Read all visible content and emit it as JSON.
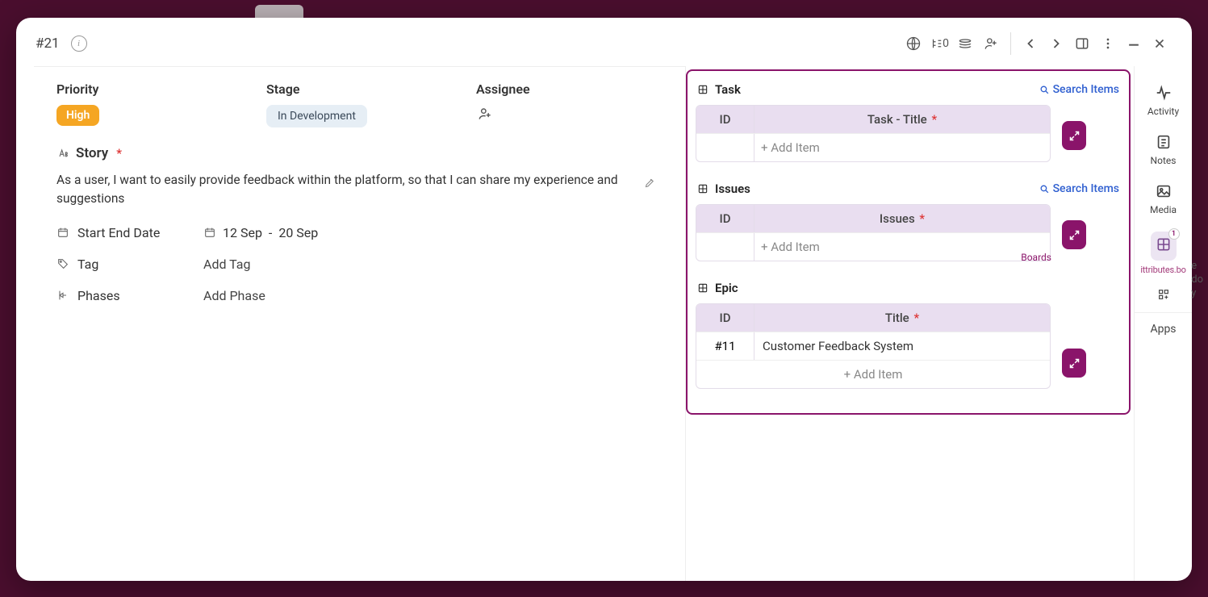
{
  "header": {
    "ticket_id": "#21",
    "link_count": "0"
  },
  "fields": {
    "priority_label": "Priority",
    "priority_value": "High",
    "stage_label": "Stage",
    "stage_value": "In Development",
    "assignee_label": "Assignee"
  },
  "story": {
    "label": "Story",
    "text": "As a user, I want to easily provide feedback within the platform, so that I can share my experience and suggestions"
  },
  "dates": {
    "label": "Start End Date",
    "start": "12 Sep",
    "end": "20 Sep",
    "sep": "-"
  },
  "tag": {
    "label": "Tag",
    "placeholder": "Add Tag"
  },
  "phases": {
    "label": "Phases",
    "placeholder": "Add Phase"
  },
  "relations": {
    "search": "Search Items",
    "boards_tooltip": "Boards",
    "task": {
      "title": "Task",
      "col_id": "ID",
      "col_title": "Task - Title",
      "add": "+ Add Item"
    },
    "issues": {
      "title": "Issues",
      "col_id": "ID",
      "col_title": "Issues",
      "add": "+ Add Item"
    },
    "epic": {
      "title": "Epic",
      "col_id": "ID",
      "col_title": "Title",
      "row_id": "#11",
      "row_title": "Customer Feedback System",
      "add": "+ Add Item"
    }
  },
  "sidebar": {
    "activity": "Activity",
    "notes": "Notes",
    "media": "Media",
    "attributes": "ittributes.bo",
    "attributes_badge": "1",
    "apps": "Apps"
  },
  "behind": "e\ndo\ny"
}
